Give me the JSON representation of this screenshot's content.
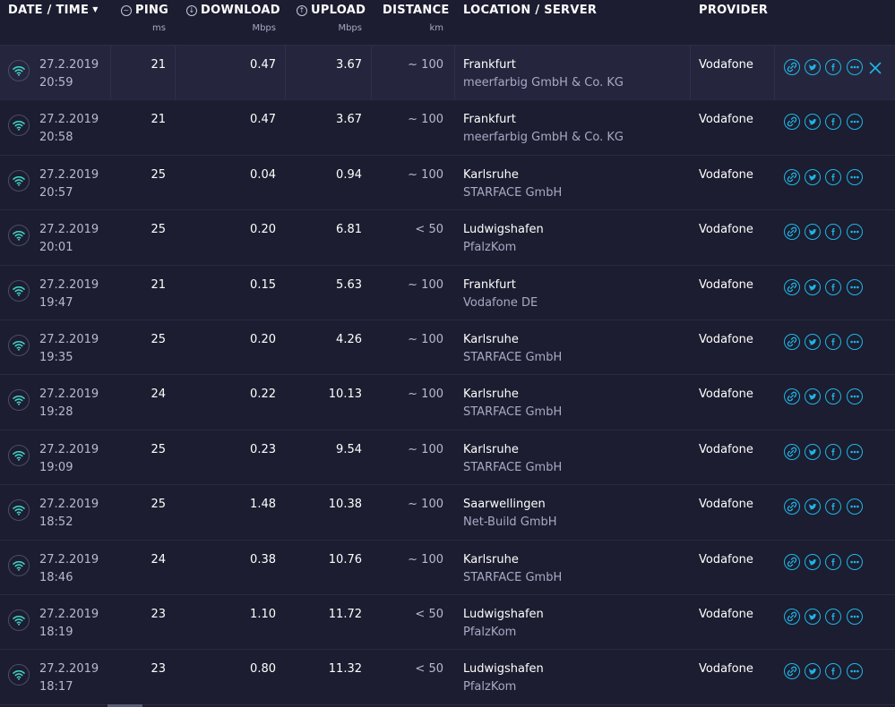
{
  "header": {
    "date_time": "DATE / TIME",
    "ping": "PING",
    "ping_unit": "ms",
    "download": "DOWNLOAD",
    "download_unit": "Mbps",
    "upload": "UPLOAD",
    "upload_unit": "Mbps",
    "distance": "DISTANCE",
    "distance_unit": "km",
    "location": "LOCATION / SERVER",
    "provider": "PROVIDER"
  },
  "colors": {
    "accent": "#1eb6e6",
    "wifi": "#3fd6c8",
    "background": "#1c1d30",
    "highlight": "#25263d"
  },
  "icons": {
    "connection": "wifi-icon",
    "actions": [
      "link-icon",
      "twitter-icon",
      "facebook-icon",
      "more-icon"
    ],
    "delete": "close-icon",
    "sort": "sort-down-icon"
  },
  "rows": [
    {
      "date": "27.2.2019",
      "time": "20:59",
      "ping": "21",
      "download": "0.47",
      "upload": "3.67",
      "distance": "~ 100",
      "location": "Frankfurt",
      "server": "meerfarbig GmbH & Co. KG",
      "provider": "Vodafone"
    },
    {
      "date": "27.2.2019",
      "time": "20:58",
      "ping": "21",
      "download": "0.47",
      "upload": "3.67",
      "distance": "~ 100",
      "location": "Frankfurt",
      "server": "meerfarbig GmbH & Co. KG",
      "provider": "Vodafone"
    },
    {
      "date": "27.2.2019",
      "time": "20:57",
      "ping": "25",
      "download": "0.04",
      "upload": "0.94",
      "distance": "~ 100",
      "location": "Karlsruhe",
      "server": "STARFACE GmbH",
      "provider": "Vodafone"
    },
    {
      "date": "27.2.2019",
      "time": "20:01",
      "ping": "25",
      "download": "0.20",
      "upload": "6.81",
      "distance": "< 50",
      "location": "Ludwigshafen",
      "server": "PfalzKom",
      "provider": "Vodafone"
    },
    {
      "date": "27.2.2019",
      "time": "19:47",
      "ping": "21",
      "download": "0.15",
      "upload": "5.63",
      "distance": "~ 100",
      "location": "Frankfurt",
      "server": "Vodafone DE",
      "provider": "Vodafone"
    },
    {
      "date": "27.2.2019",
      "time": "19:35",
      "ping": "25",
      "download": "0.20",
      "upload": "4.26",
      "distance": "~ 100",
      "location": "Karlsruhe",
      "server": "STARFACE GmbH",
      "provider": "Vodafone"
    },
    {
      "date": "27.2.2019",
      "time": "19:28",
      "ping": "24",
      "download": "0.22",
      "upload": "10.13",
      "distance": "~ 100",
      "location": "Karlsruhe",
      "server": "STARFACE GmbH",
      "provider": "Vodafone"
    },
    {
      "date": "27.2.2019",
      "time": "19:09",
      "ping": "25",
      "download": "0.23",
      "upload": "9.54",
      "distance": "~ 100",
      "location": "Karlsruhe",
      "server": "STARFACE GmbH",
      "provider": "Vodafone"
    },
    {
      "date": "27.2.2019",
      "time": "18:52",
      "ping": "25",
      "download": "1.48",
      "upload": "10.38",
      "distance": "~ 100",
      "location": "Saarwellingen",
      "server": "Net-Build GmbH",
      "provider": "Vodafone"
    },
    {
      "date": "27.2.2019",
      "time": "18:46",
      "ping": "24",
      "download": "0.38",
      "upload": "10.76",
      "distance": "~ 100",
      "location": "Karlsruhe",
      "server": "STARFACE GmbH",
      "provider": "Vodafone"
    },
    {
      "date": "27.2.2019",
      "time": "18:19",
      "ping": "23",
      "download": "1.10",
      "upload": "11.72",
      "distance": "< 50",
      "location": "Ludwigshafen",
      "server": "PfalzKom",
      "provider": "Vodafone"
    },
    {
      "date": "27.2.2019",
      "time": "18:17",
      "ping": "23",
      "download": "0.80",
      "upload": "11.32",
      "distance": "< 50",
      "location": "Ludwigshafen",
      "server": "PfalzKom",
      "provider": "Vodafone"
    }
  ]
}
